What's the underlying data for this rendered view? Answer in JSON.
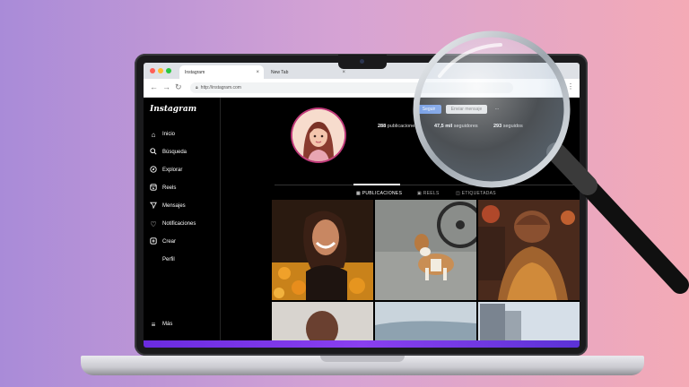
{
  "browser": {
    "tabs": [
      {
        "label": "Instagram",
        "active": true
      },
      {
        "label": "New Tab",
        "active": false
      }
    ],
    "url": "http://instagram.com"
  },
  "sidebar": {
    "logo": "Instagram",
    "items": [
      {
        "label": "Inicio",
        "icon": "home-icon"
      },
      {
        "label": "Búsqueda",
        "icon": "search-icon"
      },
      {
        "label": "Explorar",
        "icon": "compass-icon"
      },
      {
        "label": "Reels",
        "icon": "reels-icon"
      },
      {
        "label": "Mensajes",
        "icon": "send-icon"
      },
      {
        "label": "Notificaciones",
        "icon": "heart-icon"
      },
      {
        "label": "Crear",
        "icon": "plus-square-icon"
      },
      {
        "label": "Perfil",
        "icon": "none"
      }
    ],
    "more": {
      "label": "Más",
      "icon": "menu-icon"
    }
  },
  "profile": {
    "buttons": {
      "follow": "Seguir",
      "message": "Enviar mensaje",
      "more": "···"
    },
    "stats": {
      "posts": {
        "value": "288",
        "label": "publicaciones"
      },
      "followers": {
        "value": "47,5 mil",
        "label": "seguidores"
      },
      "following": {
        "value": "293",
        "label": "seguidos"
      }
    },
    "tabs": [
      {
        "label": "PUBLICACIONES",
        "icon": "grid-icon"
      },
      {
        "label": "REELS",
        "icon": "reels-icon"
      },
      {
        "label": "ETIQUETADAS",
        "icon": "tag-icon"
      }
    ]
  },
  "colors": {
    "accent_blue": "#0095f6",
    "screen_glow": "#7a36ea",
    "avatar_ring": "#c03a7a"
  }
}
